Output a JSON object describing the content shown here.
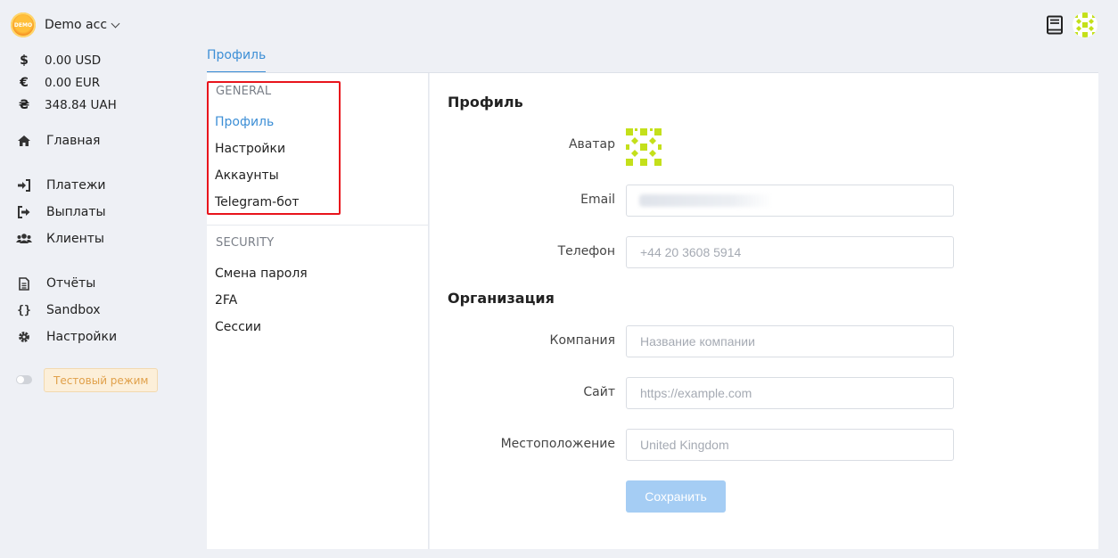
{
  "account": {
    "logo_text": "DEMO",
    "name": "Demo acc"
  },
  "balances": [
    {
      "symbol": "$",
      "amount": "0.00 USD"
    },
    {
      "symbol": "€",
      "amount": "0.00 EUR"
    },
    {
      "symbol": "₴",
      "amount": "348.84 UAH"
    }
  ],
  "nav": {
    "home": "Главная",
    "payments": "Платежи",
    "payouts": "Выплаты",
    "clients": "Клиенты",
    "reports": "Отчёты",
    "sandbox": "Sandbox",
    "settings": "Настройки"
  },
  "test_mode": {
    "label": "Тестовый режим",
    "enabled": false
  },
  "tabs": {
    "profile": "Профиль"
  },
  "settings_menu": {
    "general_header": "GENERAL",
    "general": [
      "Профиль",
      "Настройки",
      "Аккаунты",
      "Telegram-бот"
    ],
    "security_header": "SECURITY",
    "security": [
      "Смена пароля",
      "2FA",
      "Сессии"
    ]
  },
  "profile": {
    "title": "Профиль",
    "avatar_label": "Аватар",
    "email_label": "Email",
    "phone_label": "Телефон",
    "phone_placeholder": "+44 20 3608 5914"
  },
  "organization": {
    "title": "Организация",
    "company_label": "Компания",
    "company_placeholder": "Название компании",
    "site_label": "Сайт",
    "site_placeholder": "https://example.com",
    "location_label": "Местоположение",
    "location_placeholder": "United Kingdom"
  },
  "save_button": "Сохранить",
  "colors": {
    "accent": "#3d8fd6",
    "highlight_box": "#e8141c",
    "save_button_bg": "#a5cdf4",
    "avatar_pattern": "#c4e01a"
  }
}
